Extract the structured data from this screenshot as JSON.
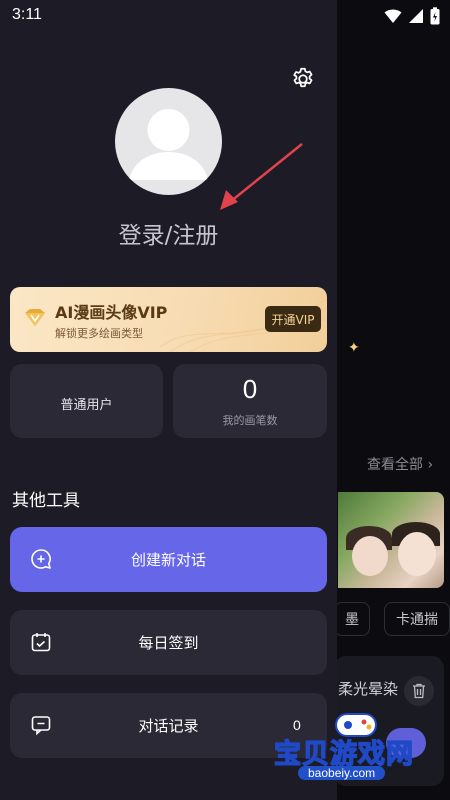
{
  "status_bar": {
    "time": "3:11"
  },
  "background_page": {
    "view_all": "查看全部 ›",
    "chips": [
      "墨",
      "卡通揣"
    ],
    "card_title": "柔光晕染"
  },
  "drawer": {
    "login_text": "登录/注册",
    "vip": {
      "title": "AI漫画头像VIP",
      "subtitle": "解锁更多绘画类型",
      "button": "开通VIP",
      "colors": {
        "card_start": "#fbe7c6",
        "card_end": "#f2cf9a",
        "button_bg": "#3a2a14",
        "button_text": "#f6d497"
      }
    },
    "stats": {
      "user_type": "普通用户",
      "brush_count": "0",
      "brush_label": "我的画笔数"
    },
    "section_title": "其他工具",
    "tools": [
      {
        "label": "创建新对话",
        "icon": "chat-plus-icon",
        "primary": true
      },
      {
        "label": "每日签到",
        "icon": "calendar-check-icon"
      },
      {
        "label": "对话记录",
        "icon": "chat-history-icon",
        "count": "0"
      }
    ],
    "accent_color": "#6566e8"
  },
  "watermark": {
    "text": "宝贝游戏网",
    "url": "baobeiy.com"
  }
}
